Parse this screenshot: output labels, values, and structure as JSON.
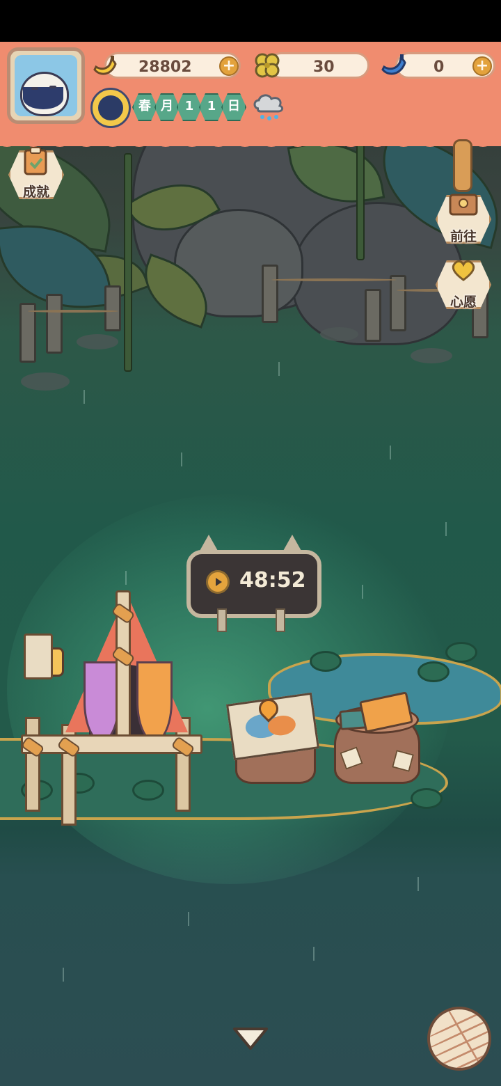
{
  "hud": {
    "currencies": [
      {
        "icon": "banana-icon",
        "value": "28802",
        "has_plus": true
      },
      {
        "icon": "clover-icon",
        "value": "30",
        "has_plus": false
      },
      {
        "icon": "blue-banana-icon",
        "value": "0",
        "has_plus": true
      }
    ],
    "date": {
      "chips": [
        "春",
        "月",
        "1",
        "1",
        "日"
      ]
    },
    "weather": "rain-cloud-icon",
    "accent_color": "#f08c6f"
  },
  "side_buttons": {
    "achievements": "成就",
    "go_to": "前往",
    "wish": "心愿"
  },
  "timer": {
    "value": "48:52"
  }
}
